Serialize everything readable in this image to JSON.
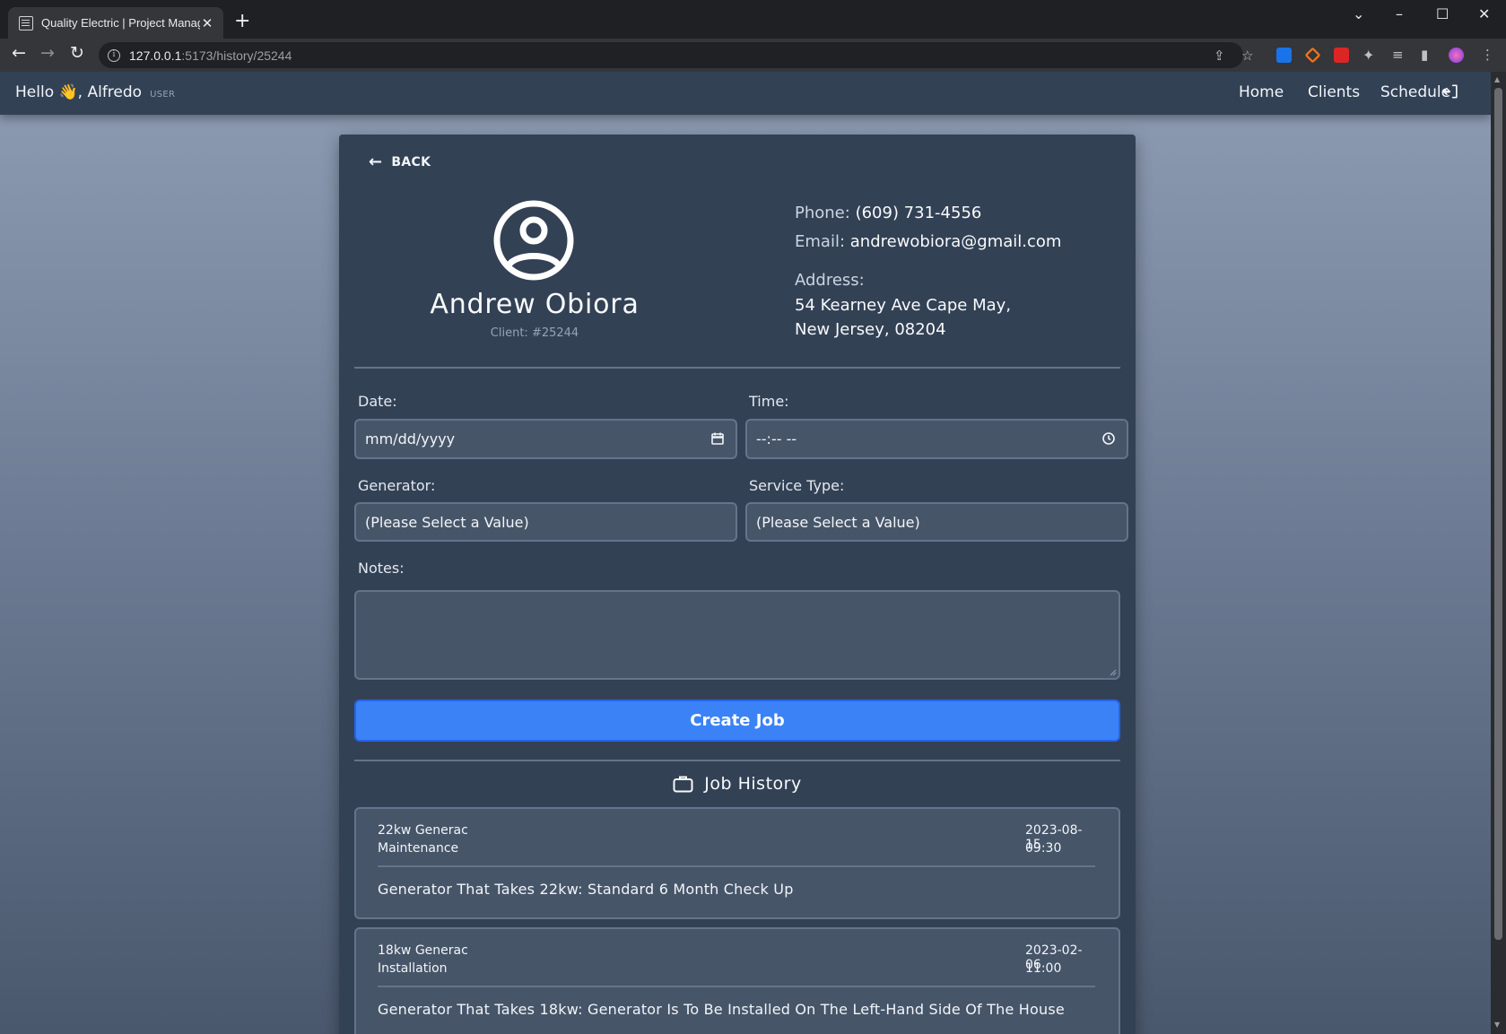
{
  "browser": {
    "tab_title": "Quality Electric | Project Manager",
    "url_host": "127.0.0.1",
    "url_path": ":5173/history/25244"
  },
  "nav": {
    "greeting": "Hello 👋, Alfredo",
    "role": "USER",
    "links": [
      "Home",
      "Clients",
      "Schedule"
    ]
  },
  "client": {
    "back_label": "BACK",
    "name": "Andrew Obiora",
    "client_id": "Client: #25244",
    "phone_label": "Phone:",
    "phone": "(609) 731-4556",
    "email_label": "Email:",
    "email": "andrewobiora@gmail.com",
    "address_label": "Address:",
    "address_line1": "54 Kearney Ave Cape May,",
    "address_line2": "New Jersey, 08204"
  },
  "form": {
    "date_label": "Date:",
    "date_value": "mm/dd/yyyy",
    "time_label": "Time:",
    "time_value": "--:-- --",
    "generator_label": "Generator:",
    "generator_value": "(Please Select a Value)",
    "service_label": "Service Type:",
    "service_value": "(Please Select a Value)",
    "notes_label": "Notes:",
    "notes_value": "",
    "submit_label": "Create Job"
  },
  "history": {
    "title": "Job History",
    "jobs": [
      {
        "generator": "22kw Generac",
        "service": "Maintenance",
        "date": "2023-08-15",
        "time": "09:30",
        "note": "Generator That Takes 22kw: Standard 6 Month Check Up"
      },
      {
        "generator": "18kw Generac",
        "service": "Installation",
        "date": "2023-02-06",
        "time": "11:00",
        "note": "Generator That Takes 18kw: Generator Is To Be Installed On The Left-Hand Side Of The House"
      }
    ]
  },
  "colors": {
    "nav_bg": "#334155",
    "card_bg": "#334155",
    "field_bg": "#475569",
    "accent": "#3b82f6"
  }
}
